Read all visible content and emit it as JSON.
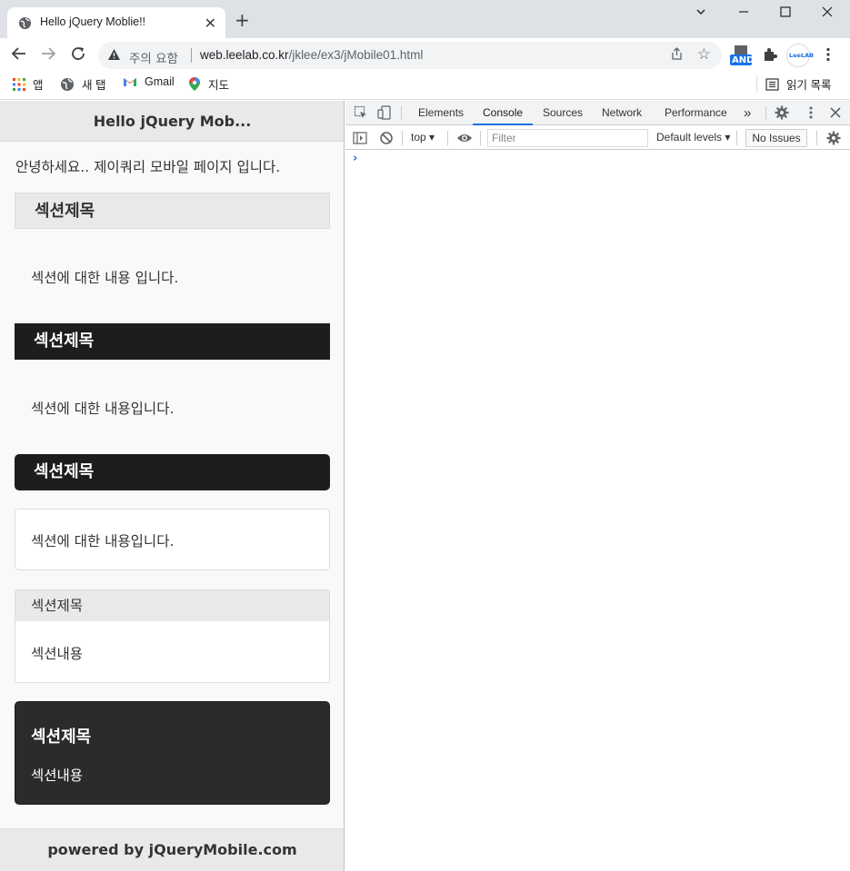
{
  "browser": {
    "tab_title": "Hello jQuery Moblie!!",
    "close_tab": "✕",
    "new_tab": "+",
    "security_label": "주의 요함",
    "url_host": "web.leelab.co.kr",
    "url_path": "/jklee/ex3/jMobile01.html",
    "profile_label": "LeeLAB",
    "ext_badge": "AND",
    "bookmarks": {
      "apps": "앱",
      "new_tab": "새 탭",
      "gmail": "Gmail",
      "maps": "지도",
      "reading_list": "읽기 목록"
    }
  },
  "page": {
    "header": "Hello jQuery Mob...",
    "intro": "안녕하세요.. 제이쿼리 모바일 페이지 입니다.",
    "sections": [
      {
        "title": "섹션제목",
        "content": "섹션에 대한 내용 입니다."
      },
      {
        "title": "섹션제목",
        "content": "섹션에 대한 내용입니다."
      },
      {
        "title": "섹션제목",
        "content": "섹션에 대한 내용입니다."
      },
      {
        "title": "섹션제목",
        "content": "섹션내용"
      },
      {
        "title": "섹션제목",
        "content": "섹션내용"
      }
    ],
    "footer": "powered by jQueryMobile.com"
  },
  "devtools": {
    "tabs": [
      "Elements",
      "Console",
      "Sources",
      "Network",
      "Performance"
    ],
    "active_tab": "Console",
    "more": "»",
    "context": "top",
    "filter_placeholder": "Filter",
    "levels": "Default levels",
    "issues": "No Issues",
    "prompt": "›"
  },
  "colors": {
    "accent": "#1a73e8",
    "bar_dark": "#1d1d1d",
    "bar_light": "#e9e9e9"
  }
}
